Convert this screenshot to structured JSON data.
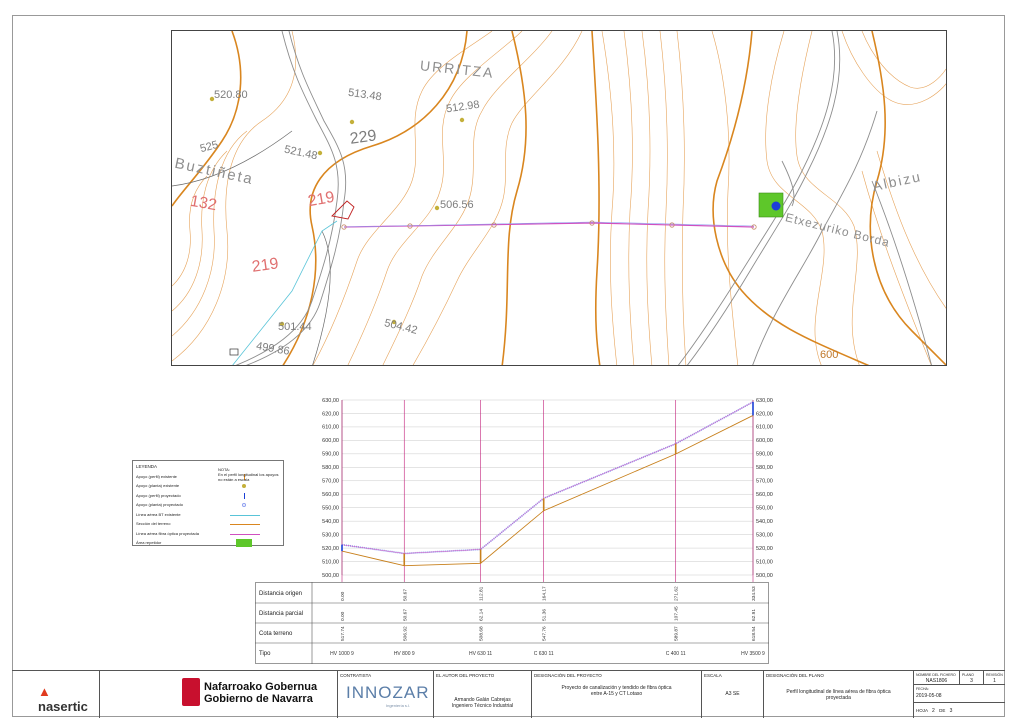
{
  "map": {
    "labels": [
      {
        "text": "URRITZA",
        "kind": "place"
      },
      {
        "text": "Buztiñeta",
        "kind": "place"
      },
      {
        "text": "Albizu",
        "kind": "place"
      },
      {
        "text": "Etxezuriko Borda",
        "kind": "place"
      },
      {
        "text": "520.80",
        "kind": "spot"
      },
      {
        "text": "513.48",
        "kind": "spot"
      },
      {
        "text": "512.98",
        "kind": "spot"
      },
      {
        "text": "525",
        "kind": "contour"
      },
      {
        "text": "521.48",
        "kind": "spot"
      },
      {
        "text": "229",
        "kind": "parcel"
      },
      {
        "text": "132",
        "kind": "parcel-red"
      },
      {
        "text": "219",
        "kind": "parcel-red"
      },
      {
        "text": "219",
        "kind": "parcel-red"
      },
      {
        "text": "506.56",
        "kind": "spot"
      },
      {
        "text": "501.44",
        "kind": "spot"
      },
      {
        "text": "504.42",
        "kind": "spot"
      },
      {
        "text": "499.86",
        "kind": "spot"
      },
      {
        "text": "600",
        "kind": "contour"
      }
    ]
  },
  "legend": {
    "title": "LEYENDA",
    "items": [
      "Apoyo (perfil) existente",
      "Apoyo (planta) existente",
      "Apoyo (perfil) proyectado",
      "Apoyo (planta) proyectado",
      "Línea aérea BT existente",
      "Sección del terreno",
      "Línea aérea fibra óptica proyectada",
      "Área repetidor"
    ],
    "note_title": "NOTA:",
    "note_text": "En el perfil longitudinal los apoyos no están a escala"
  },
  "chart_data": {
    "type": "line",
    "title": "",
    "ylim": [
      500,
      630
    ],
    "y_ticks": [
      "630,00",
      "620,00",
      "610,00",
      "600,00",
      "590,00",
      "580,00",
      "570,00",
      "560,00",
      "550,00",
      "540,00",
      "530,00",
      "520,00",
      "510,00",
      "500,00"
    ],
    "x": [
      0.0,
      50.67,
      112.81,
      164.17,
      271.62,
      334.53
    ],
    "series": [
      {
        "values": [
          517.74,
          506.92,
          508.68,
          547.76,
          589.87,
          618.54
        ]
      },
      {
        "values": [
          522.5,
          516.0,
          519.0,
          557.0,
          597.5,
          628.5
        ]
      }
    ],
    "supports": [
      "HV 1000 9",
      "HV 800 9",
      "HV 630 11",
      "C 630 11",
      "C 400 11",
      "HV 3500 9"
    ],
    "colors": {
      "terrain": "#c8801c",
      "fiber": "#d050c0",
      "support": "#c21e7a",
      "new_support": "#1a3fd6",
      "grid": "#bcbcbc"
    }
  },
  "table": {
    "row_labels": [
      "Distancia origen",
      "Distancia parcial",
      "Cota terreno",
      "Tipo"
    ],
    "origen": [
      "0.00",
      "50.67",
      "112.81",
      "164.17",
      "271.62",
      "334.53"
    ],
    "parcial": [
      "0.00",
      "50.67",
      "62.14",
      "51.36",
      "107.45",
      "62.91"
    ],
    "cota": [
      "517.74",
      "506.92",
      "508.68",
      "547.76",
      "589.87",
      "618.54"
    ],
    "tipo": [
      "HV 1000 9",
      "HV 800 9",
      "HV 630 11",
      "C 630 11",
      "C 400 11",
      "HV 3500 9"
    ]
  },
  "titleblock": {
    "logo1": "nasertic",
    "gov1": "Nafarroako Gobernua",
    "gov2": "Gobierno de Navarra",
    "contratista_cap": "CONTRATISTA",
    "contratista": "INNOZAR",
    "contratista_sub": "Ingeniería s.l.",
    "autor_cap": "EL AUTOR DEL PROYECTO",
    "autor_name": "Armando Galán Cabrejas",
    "autor_role": "Ingeniero Técnico Industrial",
    "desig_cap": "DESIGNACIÓN DEL PROYECTO",
    "desig_1": "Proyecto de canalización y tendido de fibra óptica",
    "desig_2": "entre A-15 y CT Lotaso",
    "escala_cap": "ESCALA",
    "escala": "A3 SE",
    "plano_cap": "DESIGNACIÓN DEL PLANO",
    "plano_1": "Perfil longitudinal de línea aérea de fibra óptica",
    "plano_2": "proyectada",
    "fichero_cap": "NOMBRE DEL FICHERO",
    "fichero": "NAS1806",
    "plano_n_cap": "PLANO",
    "plano_n": "3",
    "rev_cap": "REVISIÓN",
    "rev": "1",
    "fecha_cap": "FECHA:",
    "fecha": "2019-05-08",
    "hoja_cap": "HOJA",
    "hoja": "2",
    "de_cap": "DE",
    "de": "3"
  }
}
